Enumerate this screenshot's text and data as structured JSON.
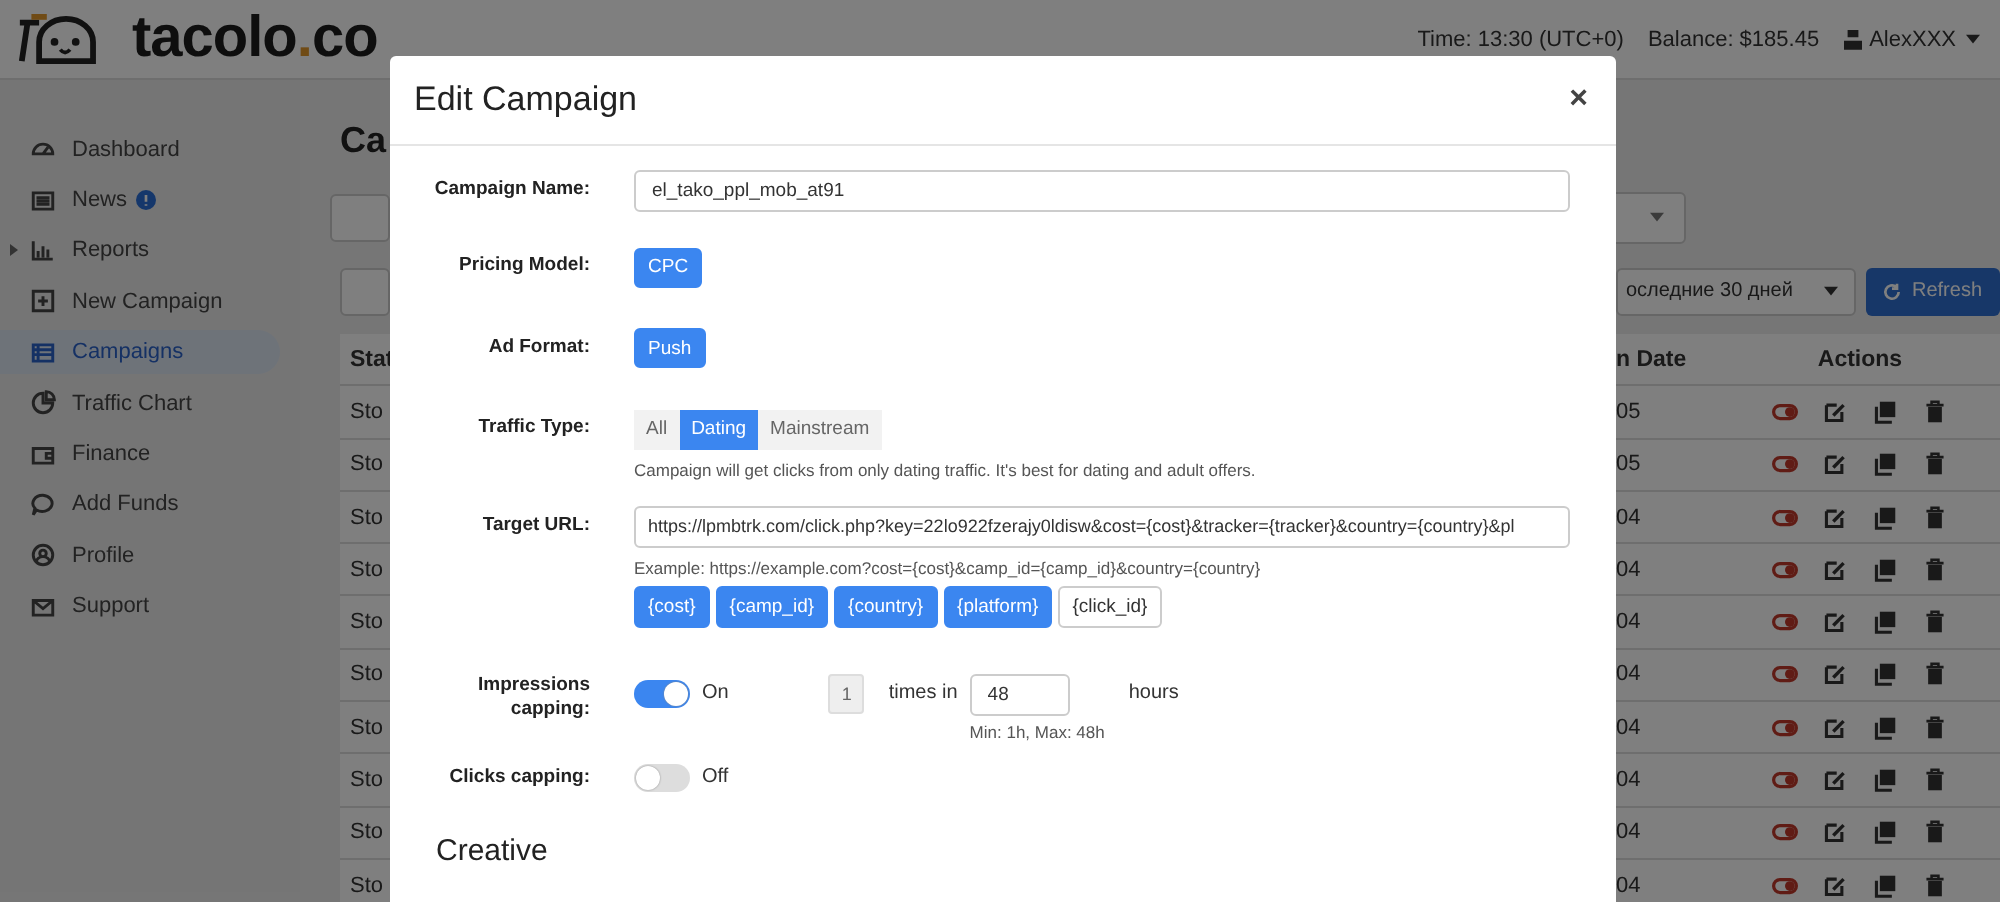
{
  "header": {
    "logo_parts": [
      "tacolo",
      ".",
      "co"
    ],
    "time": "Time: 13:30 (UTC+0)",
    "balance": "Balance: $185.45",
    "user": "AlexXXX"
  },
  "sidebar": {
    "items": [
      {
        "label": "Dashboard",
        "selected": false,
        "kind": "plain"
      },
      {
        "label": "News",
        "selected": false,
        "kind": "alert"
      },
      {
        "label": "Reports",
        "selected": false,
        "kind": "group"
      },
      {
        "label": "New Campaign",
        "selected": false,
        "kind": "plain"
      },
      {
        "label": "Campaigns",
        "selected": true,
        "kind": "plain"
      },
      {
        "label": "Traffic Chart",
        "selected": false,
        "kind": "plain"
      },
      {
        "label": "Finance",
        "selected": false,
        "kind": "plain"
      },
      {
        "label": "Add Funds",
        "selected": false,
        "kind": "plain"
      },
      {
        "label": "Profile",
        "selected": false,
        "kind": "plain"
      },
      {
        "label": "Support",
        "selected": false,
        "kind": "plain"
      }
    ]
  },
  "page": {
    "heading": "Ca",
    "period": "оследние 30 дней",
    "refresh": "Refresh",
    "table": {
      "columns": [
        "Stat",
        "n Date",
        "Actions"
      ],
      "rows": [
        {
          "column_1": "Sto",
          "column_2": "05"
        },
        {
          "column_1": "Sto",
          "column_2": "05"
        },
        {
          "column_1": "Sto",
          "column_2": "04"
        },
        {
          "column_1": "Sto",
          "column_2": "04"
        },
        {
          "column_1": "Sto",
          "column_2": "04"
        },
        {
          "column_1": "Sto",
          "column_2": "04"
        },
        {
          "column_1": "Sto",
          "column_2": "04"
        },
        {
          "column_1": "Sto",
          "column_2": "04"
        },
        {
          "column_1": "Sto",
          "column_2": "04"
        },
        {
          "column_1": "Sto",
          "column_2": "04"
        }
      ]
    }
  },
  "modal": {
    "title": "Edit Campaign",
    "close": "×",
    "campaign_name": {
      "label": "Campaign Name:",
      "value": "el_tako_ppl_mob_at91"
    },
    "pricing_model": {
      "label": "Pricing Model:",
      "value": "CPC"
    },
    "ad_format": {
      "label": "Ad Format:",
      "value": "Push"
    },
    "traffic_type": {
      "label": "Traffic Type:",
      "options": [
        {
          "label": "All",
          "selected": false
        },
        {
          "label": "Dating",
          "selected": true
        },
        {
          "label": "Mainstream",
          "selected": false
        }
      ],
      "help": "Campaign will get clicks from only dating traffic. It's best for dating and adult offers."
    },
    "target_url": {
      "label": "Target URL:",
      "value": "https://lpmbtrk.com/click.php?key=22lo922fzerajy0ldisw&cost={cost}&tracker={tracker}&country={country}&pl",
      "example": "Example: https://example.com?cost={cost}&camp_id={camp_id}&country={country}",
      "macros": [
        {
          "label": "{cost}",
          "selected": true
        },
        {
          "label": "{camp_id}",
          "selected": true
        },
        {
          "label": "{country}",
          "selected": true
        },
        {
          "label": "{platform}",
          "selected": true
        },
        {
          "label": "{click_id}",
          "selected": false
        }
      ]
    },
    "impressions_capping": {
      "label": "Impressions capping:",
      "on": true,
      "state_label": "On",
      "count": "1",
      "times_in": "times in",
      "hours_value": "48",
      "hours": "hours",
      "hint": "Min: 1h, Max: 48h"
    },
    "clicks_capping": {
      "label": "Clicks capping:",
      "on": false,
      "state_label": "Off"
    },
    "creative_heading": "Creative"
  }
}
